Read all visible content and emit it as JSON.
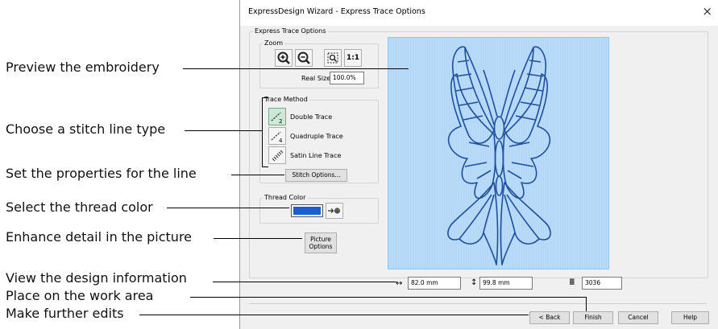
{
  "callouts": [
    "Preview the embroidery",
    "Choose a stitch line type",
    "Set the properties for the line",
    "Select the thread color",
    "Enhance detail in the picture",
    "View the design information",
    "Place on the work area",
    "Make further edits"
  ],
  "dialog": {
    "title": "ExpressDesign Wizard - Express Trace Options",
    "close": "×",
    "section_title": "Express Trace Options",
    "zoom": {
      "label": "Zoom",
      "real_size_label": "Real Size",
      "real_size_value": "100.0%",
      "one_to_one": "1:1"
    },
    "trace": {
      "label": "Trace Method",
      "options": [
        "Double Trace",
        "Quadruple Trace",
        "Satin Line Trace"
      ],
      "stitch_options": "Stitch Options..."
    },
    "thread": {
      "label": "Thread Color",
      "color": "#1a5fd1"
    },
    "picture_options": [
      "Picture",
      "Options"
    ],
    "info": {
      "width": "82.0 mm",
      "height": "99.8 mm",
      "stitches": "3036"
    },
    "buttons": {
      "back": "< Back",
      "finish": "Finish",
      "cancel": "Cancel",
      "help": "Help"
    }
  }
}
